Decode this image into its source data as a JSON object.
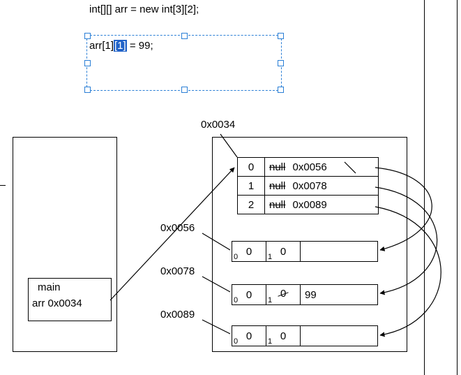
{
  "code": {
    "line1": "int[][] arr = new int[3][2];",
    "line2_pre": "arr[1]",
    "line2_hl": "[1]",
    "line2_post": " = 99;"
  },
  "stack": {
    "frame_label": "main",
    "var_label": "arr",
    "var_value": "0x0034"
  },
  "heap": {
    "outer_addr": "0x0034",
    "outer_rows": [
      {
        "index": "0",
        "old": "null",
        "addr": "0x0056"
      },
      {
        "index": "1",
        "old": "null",
        "addr": "0x0078"
      },
      {
        "index": "2",
        "old": "null",
        "addr": "0x0089"
      }
    ],
    "inner": [
      {
        "addr": "0x0056",
        "cells": [
          {
            "idx": "0",
            "val": "0"
          },
          {
            "idx": "1",
            "val": "0"
          }
        ]
      },
      {
        "addr": "0x0078",
        "cells": [
          {
            "idx": "0",
            "val": "0"
          },
          {
            "idx": "1",
            "val": "99",
            "old": "0"
          }
        ]
      },
      {
        "addr": "0x0089",
        "cells": [
          {
            "idx": "0",
            "val": "0"
          },
          {
            "idx": "1",
            "val": "0"
          }
        ]
      }
    ]
  }
}
